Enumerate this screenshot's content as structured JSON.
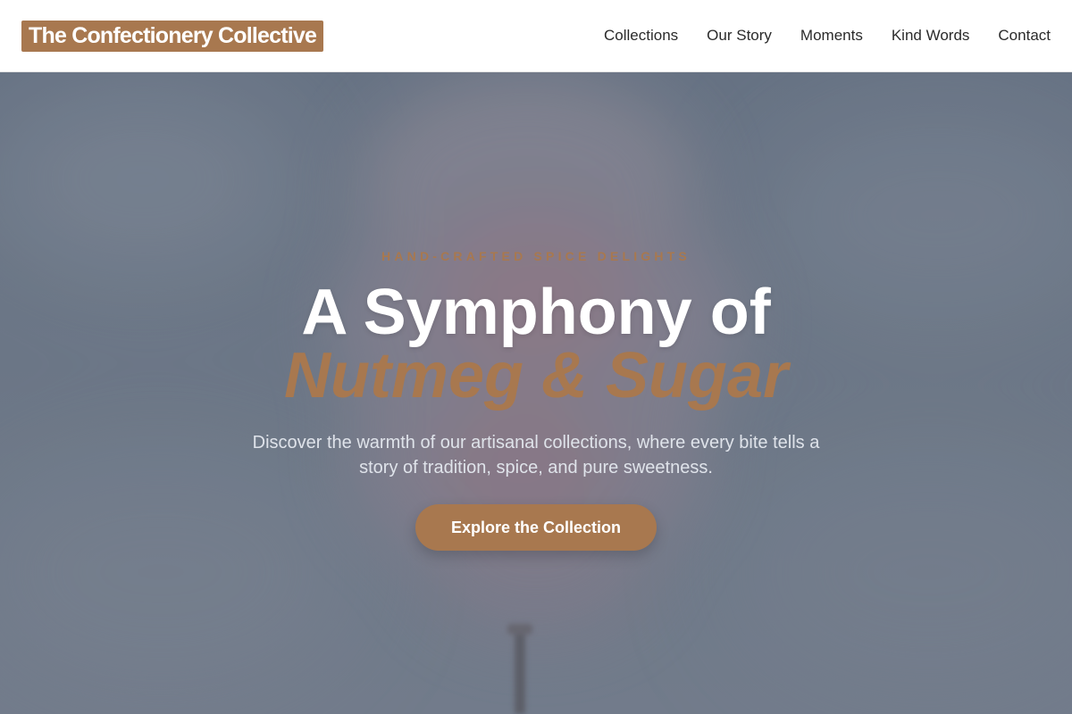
{
  "header": {
    "logo": "The Confectionery Collective",
    "nav": [
      "Collections",
      "Our Story",
      "Moments",
      "Kind Words",
      "Contact"
    ]
  },
  "hero": {
    "eyebrow": "HAND-CRAFTED SPICE DELIGHTS",
    "title": "A Symphony of",
    "title_accent": "Nutmeg & Sugar",
    "subtitle": "Discover the warmth of our artisanal collections, where every bite tells a story of tradition, spice, and pure sweetness.",
    "cta": "Explore the Collection"
  },
  "colors": {
    "accent": "#a8784f",
    "header_bg": "#ffffff",
    "hero_overlay": "#6f7a88"
  }
}
